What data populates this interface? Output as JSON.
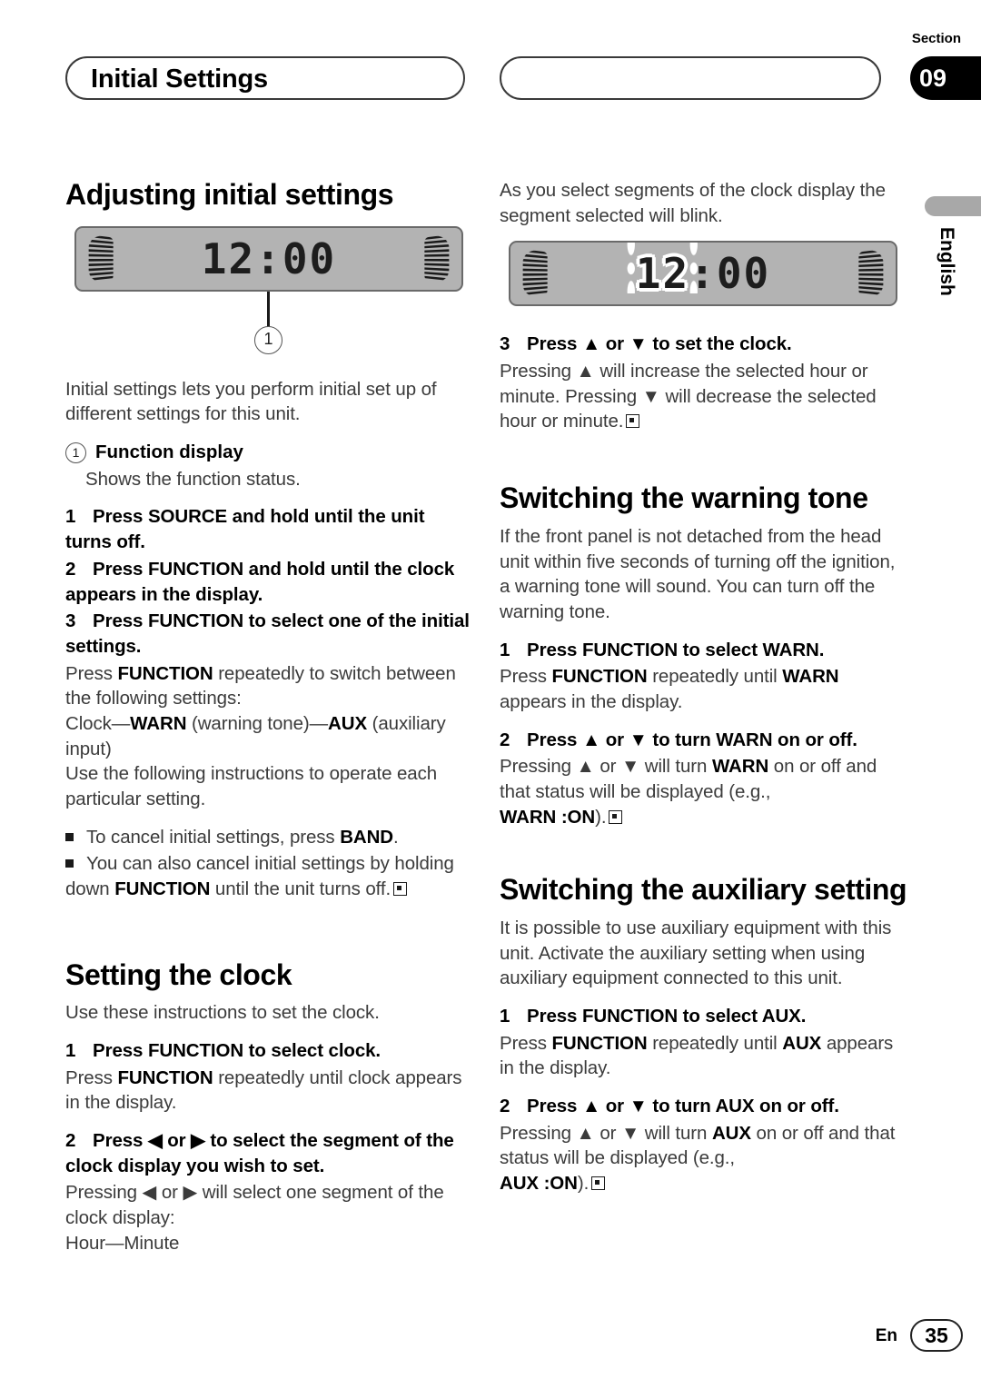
{
  "header": {
    "title": "Initial Settings",
    "section_label": "Section",
    "section_number": "09"
  },
  "side_tab": {
    "language": "English"
  },
  "footer": {
    "lang_code": "En",
    "page_number": "35"
  },
  "left_column": {
    "heading": "Adjusting initial settings",
    "device": {
      "lcd_text": "12:00",
      "callout_number": "1"
    },
    "intro": "Initial settings lets you perform initial set up of different settings for this unit.",
    "callout_marker": "1",
    "callout_title": "Function display",
    "callout_desc": "Shows the function status.",
    "steps": [
      {
        "num": "1",
        "text": "Press SOURCE and hold until the unit turns off."
      },
      {
        "num": "2",
        "text": "Press FUNCTION and hold until the clock appears in the display."
      },
      {
        "num": "3",
        "text": "Press FUNCTION to select one of the initial settings."
      }
    ],
    "step3_body_1_pre": "Press ",
    "step3_body_1_bold": "FUNCTION",
    "step3_body_1_post": " repeatedly to switch between the following settings:",
    "step3_body_2_a": "Clock—",
    "step3_body_2_b": "WARN",
    "step3_body_2_c": " (warning tone)—",
    "step3_body_2_d": "AUX",
    "step3_body_2_e": " (auxiliary input)",
    "step3_body_3": "Use the following instructions to operate each particular setting.",
    "bullets": [
      {
        "pre": "To cancel initial settings, press ",
        "bold": "BAND",
        "post": "."
      },
      {
        "pre": "You can also cancel initial settings by holding down ",
        "bold": "FUNCTION",
        "post": " until the unit turns off."
      }
    ],
    "clock_heading": "Setting the clock",
    "clock_intro": "Use these instructions to set the clock.",
    "clock_step1_num": "1",
    "clock_step1_text": "Press FUNCTION to select clock.",
    "clock_step1_body_pre": "Press ",
    "clock_step1_body_bold": "FUNCTION",
    "clock_step1_body_post": " repeatedly until clock appears in the display.",
    "clock_step2_num": "2",
    "clock_step2_text": "Press ◀ or ▶ to select the segment of the clock display you wish to set.",
    "clock_step2_body": "Pressing ◀ or ▶ will select one segment of the clock display:",
    "clock_step2_body_2": "Hour—Minute"
  },
  "right_column": {
    "intro": "As you select segments of the clock display the segment selected will blink.",
    "device": {
      "lcd_blink_digit": "12",
      "lcd_rest": ":00"
    },
    "step3_num": "3",
    "step3_text": "Press ▲ or ▼ to set the clock.",
    "step3_body": "Pressing ▲ will increase the selected hour or minute. Pressing ▼ will decrease the selected hour or minute.",
    "warn_heading": "Switching the warning tone",
    "warn_intro": "If the front panel is not detached from the head unit within five seconds of turning off the ignition, a warning tone will sound. You can turn off the warning tone.",
    "warn_step1_num": "1",
    "warn_step1_text": "Press FUNCTION to select WARN.",
    "warn_step1_body_pre": "Press ",
    "warn_step1_body_b1": "FUNCTION",
    "warn_step1_body_mid": " repeatedly until ",
    "warn_step1_body_b2": "WARN",
    "warn_step1_body_post": " appears in the display.",
    "warn_step2_num": "2",
    "warn_step2_text": "Press ▲ or ▼ to turn WARN on or off.",
    "warn_step2_body_pre": "Pressing ▲ or ▼ will turn ",
    "warn_step2_body_b1": "WARN",
    "warn_step2_body_post": " on or off and that status will be displayed (e.g.,",
    "warn_step2_status": "WARN :ON",
    "warn_step2_tail": ").",
    "aux_heading": "Switching the auxiliary setting",
    "aux_intro": "It is possible to use auxiliary equipment with this unit. Activate the auxiliary setting when using auxiliary equipment connected to this unit.",
    "aux_step1_num": "1",
    "aux_step1_text": "Press FUNCTION to select AUX.",
    "aux_step1_body_pre": "Press ",
    "aux_step1_body_b1": "FUNCTION",
    "aux_step1_body_mid": " repeatedly until ",
    "aux_step1_body_b2": "AUX",
    "aux_step1_body_post": " appears in the display.",
    "aux_step2_num": "2",
    "aux_step2_text": "Press ▲ or ▼ to turn AUX on or off.",
    "aux_step2_body_pre": "Pressing ▲ or ▼ will turn ",
    "aux_step2_body_b1": "AUX",
    "aux_step2_body_post": " on or off and that status will be displayed (e.g.,",
    "aux_step2_status": "AUX :ON",
    "aux_step2_tail": ")."
  }
}
